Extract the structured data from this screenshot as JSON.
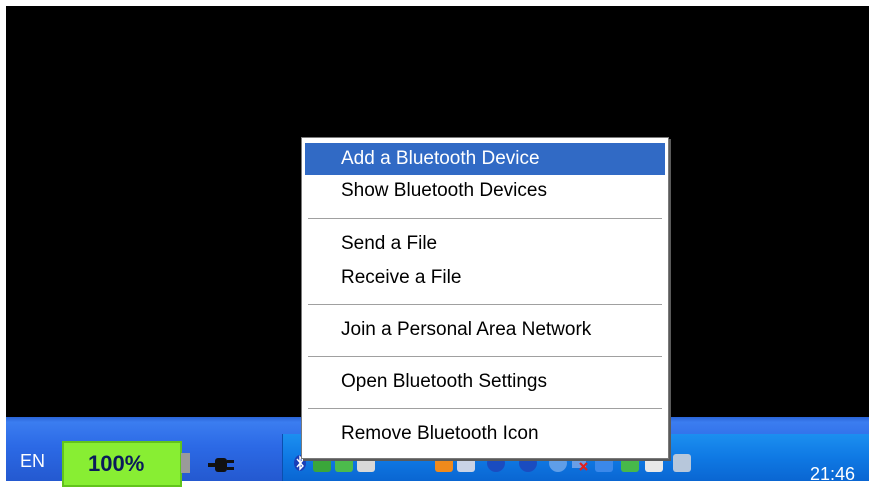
{
  "taskbar": {
    "language": "EN",
    "battery": {
      "level_text": "100%",
      "level_percent": 100,
      "fill_color": "#88ee33"
    },
    "power_icon": "ac-plug-icon",
    "clock": "21:46",
    "tray_icons": [
      "bluetooth-icon",
      "green-app-icon",
      "network-icon",
      "speaker-icon",
      "orange-app-icon",
      "pen-icon",
      "info-icon",
      "clock-icon",
      "security-icon",
      "red-x-icon",
      "arrow-icon",
      "green-shield-icon",
      "usb-icon",
      "network-connection-icon"
    ]
  },
  "context_menu": {
    "items": [
      {
        "label": "Add a Bluetooth Device",
        "highlighted": true
      },
      {
        "label": "Show Bluetooth Devices"
      },
      {
        "label": "Send a File"
      },
      {
        "label": "Receive a File"
      },
      {
        "label": "Join a Personal Area Network"
      },
      {
        "label": "Open Bluetooth Settings"
      },
      {
        "label": "Remove Bluetooth Icon"
      }
    ]
  },
  "colors": {
    "desktop": "#000000",
    "taskbar": "#2c6ae6",
    "tray": "#0f79e4",
    "menu_highlight": "#316ac5"
  }
}
